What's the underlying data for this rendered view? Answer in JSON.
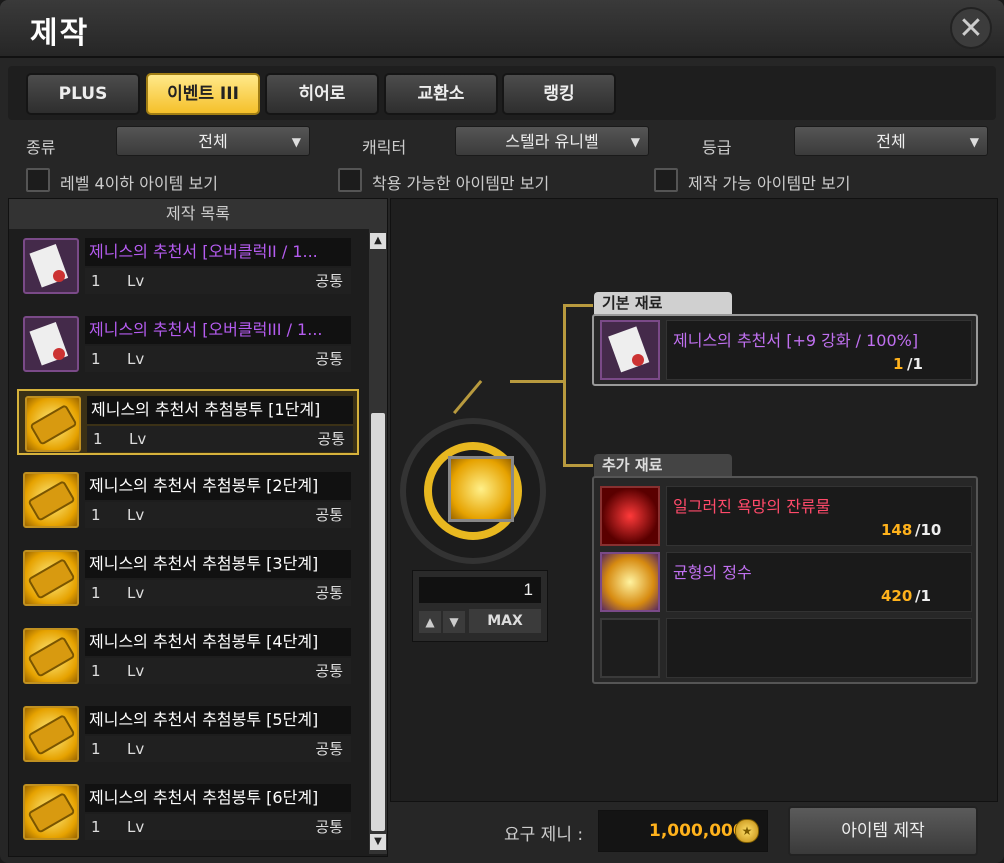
{
  "window": {
    "title": "제작",
    "close_label": "✕"
  },
  "tabs": [
    {
      "label": "PLUS",
      "active": false
    },
    {
      "label": "이벤트 III",
      "active": true
    },
    {
      "label": "히어로",
      "active": false
    },
    {
      "label": "교환소",
      "active": false
    },
    {
      "label": "랭킹",
      "active": false
    }
  ],
  "filters": {
    "type_label": "종류",
    "type_value": "전체",
    "character_label": "캐릭터",
    "character_value": "스텔라 유니벨",
    "grade_label": "등급",
    "grade_value": "전체"
  },
  "checkboxes": [
    {
      "label": "레벨 4이하 아이템 보기",
      "checked": false
    },
    {
      "label": "착용 가능한 아이템만 보기",
      "checked": false
    },
    {
      "label": "제작 가능 아이템만 보기",
      "checked": false
    }
  ],
  "list": {
    "header": "제작 목록",
    "items": [
      {
        "name": "제니스의 추천서 [오버클럭II / 1...",
        "count": "1",
        "lv": "Lv",
        "class": "공통",
        "icon": "recommendation-letter-icon",
        "name_color": "#b55cf0",
        "selected": false
      },
      {
        "name": "제니스의 추천서 [오버클럭III / 1...",
        "count": "1",
        "lv": "Lv",
        "class": "공통",
        "icon": "recommendation-letter-icon",
        "name_color": "#b55cf0",
        "selected": false
      },
      {
        "name": "제니스의 추천서 추첨봉투 [1단계]",
        "count": "1",
        "lv": "Lv",
        "class": "공통",
        "icon": "golden-ticket-icon",
        "name_color": "#ffffff",
        "selected": true
      },
      {
        "name": "제니스의 추천서 추첨봉투 [2단계]",
        "count": "1",
        "lv": "Lv",
        "class": "공통",
        "icon": "golden-ticket-icon",
        "name_color": "#ffffff",
        "selected": false
      },
      {
        "name": "제니스의 추천서 추첨봉투 [3단계]",
        "count": "1",
        "lv": "Lv",
        "class": "공통",
        "icon": "golden-ticket-icon",
        "name_color": "#ffffff",
        "selected": false
      },
      {
        "name": "제니스의 추천서 추첨봉투 [4단계]",
        "count": "1",
        "lv": "Lv",
        "class": "공통",
        "icon": "golden-ticket-icon",
        "name_color": "#ffffff",
        "selected": false
      },
      {
        "name": "제니스의 추천서 추첨봉투 [5단계]",
        "count": "1",
        "lv": "Lv",
        "class": "공통",
        "icon": "golden-ticket-icon",
        "name_color": "#ffffff",
        "selected": false
      },
      {
        "name": "제니스의 추천서 추첨봉투 [6단계]",
        "count": "1",
        "lv": "Lv",
        "class": "공통",
        "icon": "golden-ticket-icon",
        "name_color": "#ffffff",
        "selected": false
      }
    ]
  },
  "craft": {
    "quantity": "1",
    "max_label": "MAX",
    "base_materials_label": "기본 재료",
    "base_materials": [
      {
        "name": "제니스의 추천서 [+9 강화 / 100%]",
        "have": "1",
        "need": "/1",
        "icon": "recommendation-letter-icon",
        "name_color": "#c070f0"
      }
    ],
    "extra_materials_label": "추가 재료",
    "extra_materials": [
      {
        "name": "일그러진 욕망의 잔류물",
        "have": "148",
        "need": "/10",
        "icon": "distorted-desire-residue-icon",
        "name_color": "#ff4a6a"
      },
      {
        "name": "균형의 정수",
        "have": "420",
        "need": "/1",
        "icon": "essence-of-balance-icon",
        "name_color": "#c070f0"
      }
    ],
    "required_meso_label": "요구 제니 :",
    "required_meso": "1,000,000",
    "craft_button": "아이템 제작"
  }
}
